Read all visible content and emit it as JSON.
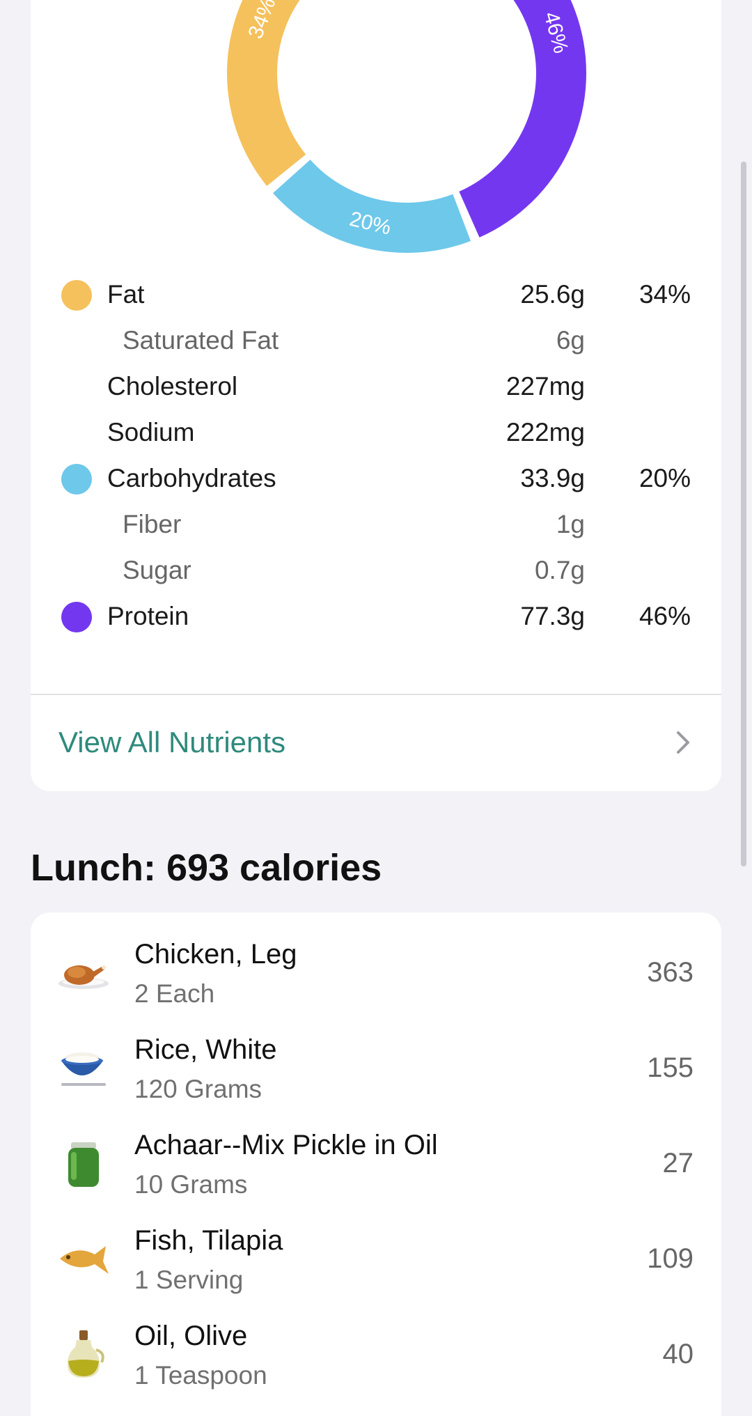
{
  "macro_chart": {
    "slices": [
      {
        "name": "Fat",
        "percent": 34,
        "label": "34%",
        "color": "#f5c15c"
      },
      {
        "name": "Carbohydrates",
        "percent": 20,
        "label": "20%",
        "color": "#6ec8ea"
      },
      {
        "name": "Protein",
        "percent": 46,
        "label": "46%",
        "color": "#7437f0"
      }
    ]
  },
  "nutrients": [
    {
      "label": "Fat",
      "amount": "25.6g",
      "percent": "34%",
      "dot_color": "#f5c15c",
      "sub": false
    },
    {
      "label": "Saturated Fat",
      "amount": "6g",
      "percent": "",
      "dot_color": "",
      "sub": true
    },
    {
      "label": "Cholesterol",
      "amount": "227mg",
      "percent": "",
      "dot_color": "",
      "sub": false
    },
    {
      "label": "Sodium",
      "amount": "222mg",
      "percent": "",
      "dot_color": "",
      "sub": false
    },
    {
      "label": "Carbohydrates",
      "amount": "33.9g",
      "percent": "20%",
      "dot_color": "#6ec8ea",
      "sub": false
    },
    {
      "label": "Fiber",
      "amount": "1g",
      "percent": "",
      "dot_color": "",
      "sub": true
    },
    {
      "label": "Sugar",
      "amount": "0.7g",
      "percent": "",
      "dot_color": "",
      "sub": true
    },
    {
      "label": "Protein",
      "amount": "77.3g",
      "percent": "46%",
      "dot_color": "#7437f0",
      "sub": false
    }
  ],
  "view_all": {
    "label": "View All Nutrients",
    "icon": "chevron-right-icon"
  },
  "lunch": {
    "title": "Lunch: 693 calories",
    "items": [
      {
        "name": "Chicken, Leg",
        "serving": "2 Each",
        "calories": "363",
        "icon": "roast-chicken-icon"
      },
      {
        "name": "Rice, White",
        "serving": "120 Grams",
        "calories": "155",
        "icon": "rice-bowl-icon"
      },
      {
        "name": "Achaar--Mix Pickle in Oil",
        "serving": "10 Grams",
        "calories": "27",
        "icon": "pickle-jar-icon"
      },
      {
        "name": "Fish, Tilapia",
        "serving": "1 Serving",
        "calories": "109",
        "icon": "fish-icon"
      },
      {
        "name": "Oil, Olive",
        "serving": "1 Teaspoon",
        "calories": "40",
        "icon": "olive-oil-icon"
      }
    ]
  },
  "colors": {
    "accent": "#2e8a7c",
    "background": "#f2f2f7"
  }
}
